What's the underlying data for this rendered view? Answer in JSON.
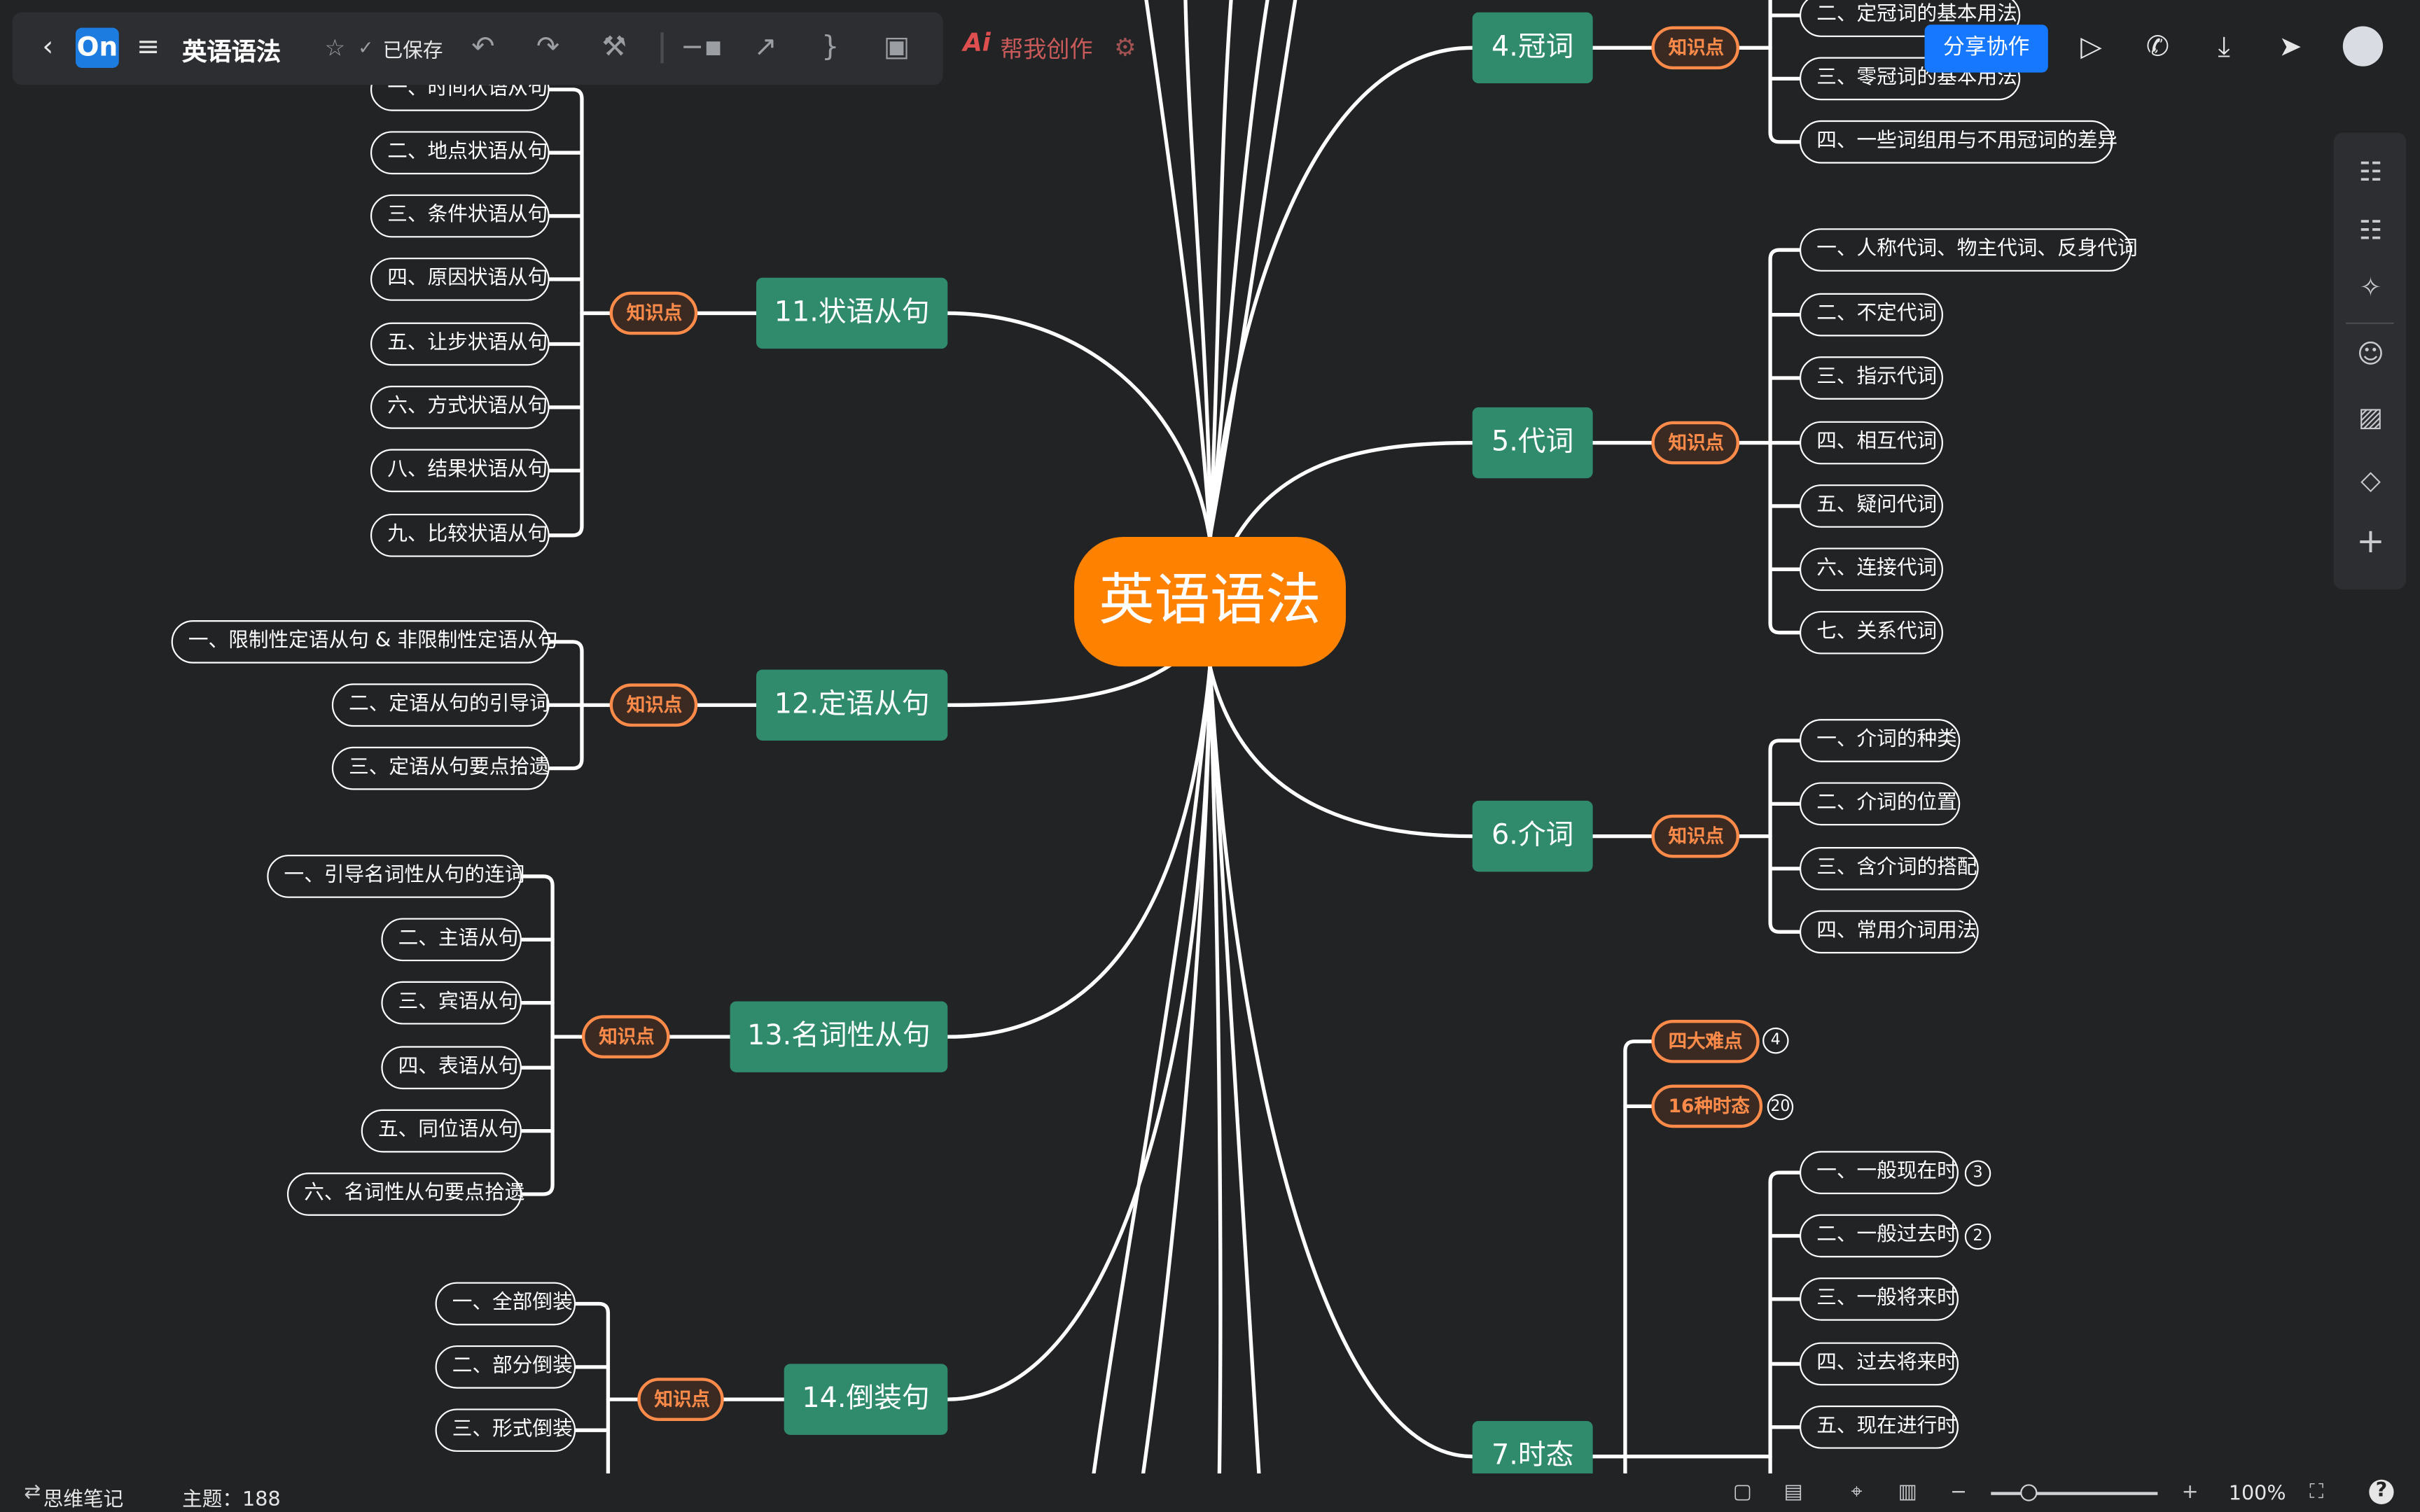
{
  "app": {
    "doc_title": "英语语法",
    "saved_label": "已保存",
    "ai_icon_label": "Ai",
    "ai_label": "帮我创作",
    "share_label": "分享协作",
    "footer_mode": "思维笔记",
    "footer_count": "主题：188",
    "zoom": "100%"
  },
  "colors": {
    "background": "#222325",
    "branch_fill": "#2f8b6c",
    "center_fill": "#ff8100",
    "tag_border": "#ff8b4a",
    "primary": "#1677ff"
  },
  "icons": {
    "toolbar": [
      "back-icon",
      "menu-icon",
      "star-icon",
      "saved-check-icon",
      "undo-icon",
      "redo-icon",
      "format-painter-icon",
      "connector-icon",
      "arrow-line-icon",
      "summary-icon",
      "frame-icon",
      "settings-gear-icon"
    ],
    "top_right": [
      "present-icon",
      "call-icon",
      "download-icon",
      "send-icon",
      "avatar"
    ],
    "right_panel": [
      "style-icon",
      "structure-icon",
      "ai-magic-icon",
      "emoji-icon",
      "image-icon",
      "tag-icon",
      "add-icon"
    ],
    "status": [
      "swap-icon",
      "lock-icon",
      "layout-icon",
      "locate-icon",
      "map-icon",
      "zoom-out-icon",
      "zoom-in-icon",
      "fullscreen-icon",
      "help-icon"
    ]
  },
  "mindmap": {
    "center": "英语语法",
    "tag_label": "知识点",
    "nodes": {
      "b11": "11.状语从句",
      "b12": "12.定语从句",
      "b13": "13.名词性从句",
      "b14": "14.倒装句",
      "b4": "4.冠词",
      "b5": "5.代词",
      "b6": "6.介词",
      "b7": "7.时态",
      "l11_1": "一、时间状语从句",
      "l11_2": "二、地点状语从句",
      "l11_3": "三、条件状语从句",
      "l11_4": "四、原因状语从句",
      "l11_5": "五、让步状语从句",
      "l11_6": "六、方式状语从句",
      "l11_7": "八、结果状语从句",
      "l11_8": "九、比较状语从句",
      "l12_1": "一、限制性定语从句 & 非限制性定语从句",
      "l12_2": "二、定语从句的引导词",
      "l12_3": "三、定语从句要点拾遗",
      "l13_1": "一、引导名词性从句的连词",
      "l13_2": "二、主语从句",
      "l13_3": "三、宾语从句",
      "l13_4": "四、表语从句",
      "l13_5": "五、同位语从句",
      "l13_6": "六、名词性从句要点拾遗",
      "l14_1": "一、全部倒装",
      "l14_2": "二、部分倒装",
      "l14_3": "三、形式倒装",
      "l4_1": "二、定冠词的基本用法",
      "l4_2": "三、零冠词的基本用法",
      "l4_3": "四、一些词组用与不用冠词的差异",
      "l5_1": "一、人称代词、物主代词、反身代词",
      "l5_2": "二、不定代词",
      "l5_3": "三、指示代词",
      "l5_4": "四、相互代词",
      "l5_5": "五、疑问代词",
      "l5_6": "六、连接代词",
      "l5_7": "七、关系代词",
      "l6_1": "一、介词的种类",
      "l6_2": "二、介词的位置",
      "l6_3": "三、含介词的搭配",
      "l6_4": "四、常用介词用法",
      "t7_1": "四大难点",
      "t7_2": "16种时态",
      "l7_1": "一、一般现在时",
      "l7_2": "二、一般过去时",
      "l7_3": "三、一般将来时",
      "l7_4": "四、过去将来时",
      "l7_5": "五、现在进行时"
    },
    "badges": {
      "t7_1": "4",
      "t7_2": "20",
      "l7_1": "3",
      "l7_2": "2"
    }
  }
}
